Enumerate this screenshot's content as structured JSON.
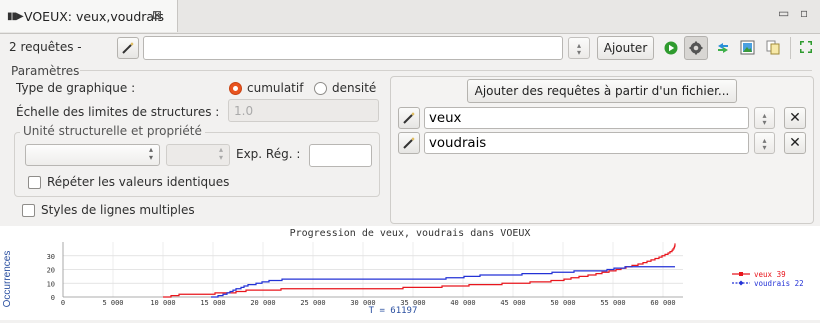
{
  "tab": {
    "title": "VOEUX: veux,voudrais",
    "close_glyph": "⊠"
  },
  "window": {
    "minimize_glyph": "▭",
    "maximize_glyph": "▫"
  },
  "toolbar": {
    "query_count_label": "2 requêtes -",
    "query_value": "",
    "add_label": "Ajouter",
    "icons": [
      "run-icon",
      "settings-icon",
      "share-icon",
      "export-image-icon",
      "copy-icon",
      "fullscreen-icon"
    ]
  },
  "params": {
    "title": "Paramètres",
    "graph_type_label": "Type de graphique :",
    "cumulative_label": "cumulatif",
    "density_label": "densité",
    "selected": "cumulatif",
    "scale_label": "Échelle des limites de structures :",
    "scale_value": "1.0",
    "struct_group_title": "Unité structurelle et propriété",
    "regex_label": "Exp. Rég. :",
    "regex_value": "",
    "repeat_label": "Répéter les valeurs identiques",
    "multi_styles_label": "Styles de lignes multiples"
  },
  "queries": {
    "add_from_file_label": "Ajouter des requêtes à partir d'un fichier...",
    "items": [
      {
        "value": "veux"
      },
      {
        "value": "voudrais"
      }
    ]
  },
  "colors": {
    "veux": "#e8161d",
    "voudrais": "#2332d6",
    "accent": "#e9541f"
  },
  "chart_data": {
    "type": "line",
    "title": "Progression de veux, voudrais dans VOEUX",
    "ylabel": "Occurrences",
    "xlabel": "T = 61197",
    "xlim": [
      0,
      62000
    ],
    "ylim": [
      0,
      40
    ],
    "xticks": [
      0,
      5000,
      10000,
      15000,
      20000,
      25000,
      30000,
      35000,
      40000,
      45000,
      50000,
      55000,
      60000
    ],
    "xtick_labels": [
      "0",
      "5 000",
      "10 000",
      "15 000",
      "20 000",
      "25 000",
      "30 000",
      "35 000",
      "40 000",
      "45 000",
      "50 000",
      "55 000",
      "60 000"
    ],
    "yticks": [
      0,
      10,
      20,
      30
    ],
    "ytick_labels": [
      "0",
      "10",
      "20",
      "30"
    ],
    "grid": true,
    "legend": "right",
    "series": [
      {
        "name": "veux 39",
        "legend_label": "veux 39",
        "color": "#e8161d",
        "marker": "square",
        "points": [
          [
            10000,
            0
          ],
          [
            10800,
            1
          ],
          [
            11600,
            2
          ],
          [
            15200,
            3
          ],
          [
            17300,
            4
          ],
          [
            18300,
            5
          ],
          [
            21800,
            6
          ],
          [
            34000,
            7
          ],
          [
            37900,
            8
          ],
          [
            40600,
            9
          ],
          [
            43900,
            10
          ],
          [
            46700,
            11
          ],
          [
            48800,
            12
          ],
          [
            50100,
            13
          ],
          [
            50800,
            14
          ],
          [
            51600,
            15
          ],
          [
            52500,
            16
          ],
          [
            53300,
            17
          ],
          [
            53900,
            18
          ],
          [
            54600,
            19
          ],
          [
            55300,
            20
          ],
          [
            55800,
            21
          ],
          [
            56300,
            22
          ],
          [
            56900,
            23
          ],
          [
            57500,
            24
          ],
          [
            58000,
            25
          ],
          [
            58400,
            26
          ],
          [
            58800,
            27
          ],
          [
            59200,
            28
          ],
          [
            59600,
            29
          ],
          [
            59900,
            30
          ],
          [
            60200,
            31
          ],
          [
            60500,
            32
          ],
          [
            60700,
            33
          ],
          [
            60900,
            34
          ],
          [
            61000,
            35
          ],
          [
            61100,
            36
          ],
          [
            61150,
            37
          ],
          [
            61197,
            38
          ],
          [
            61197,
            39
          ]
        ]
      },
      {
        "name": "voudrais 22",
        "legend_label": "voudrais 22",
        "color": "#2332d6",
        "marker": "diamond",
        "points": [
          [
            14800,
            0
          ],
          [
            15500,
            1
          ],
          [
            16000,
            2
          ],
          [
            16400,
            3
          ],
          [
            16700,
            4
          ],
          [
            17000,
            5
          ],
          [
            17300,
            6
          ],
          [
            17800,
            7
          ],
          [
            18100,
            8
          ],
          [
            18500,
            9
          ],
          [
            19300,
            10
          ],
          [
            19900,
            11
          ],
          [
            20600,
            12
          ],
          [
            21900,
            13
          ],
          [
            38300,
            14
          ],
          [
            40100,
            15
          ],
          [
            41700,
            16
          ],
          [
            45900,
            17
          ],
          [
            48900,
            18
          ],
          [
            51100,
            19
          ],
          [
            54400,
            20
          ],
          [
            55100,
            21
          ],
          [
            56200,
            22
          ],
          [
            61197,
            22
          ]
        ]
      }
    ]
  }
}
